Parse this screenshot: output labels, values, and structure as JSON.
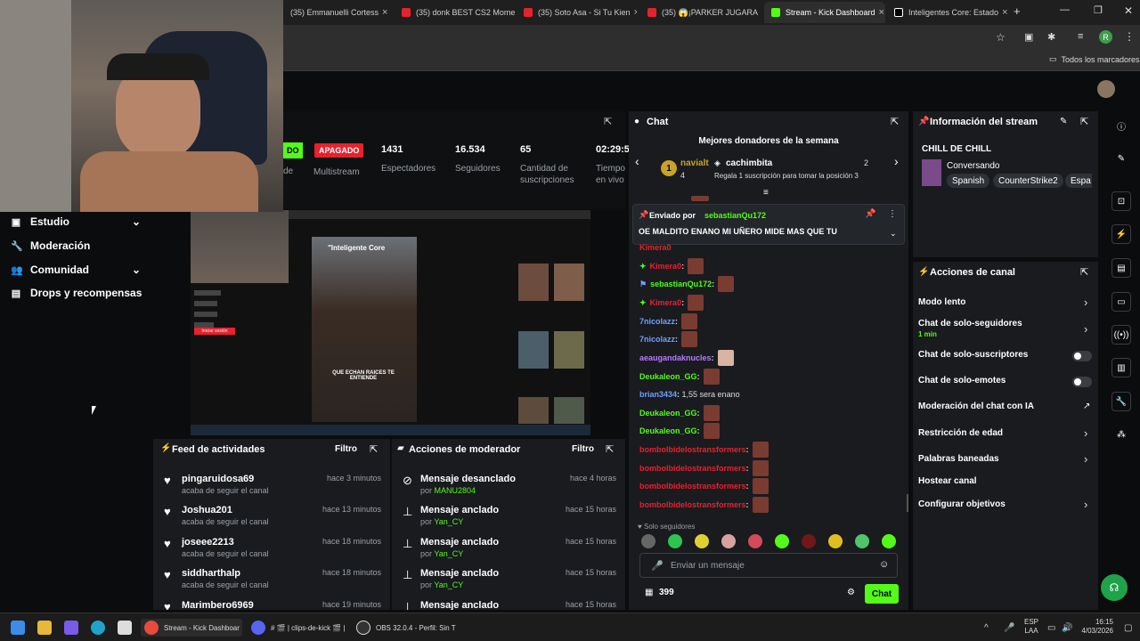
{
  "browser": {
    "tabs": [
      {
        "label": "(35) Emmanuelli Cortess",
        "icon": "youtube-icon"
      },
      {
        "label": "(35) donk BEST CS2 Mome",
        "icon": "youtube-icon"
      },
      {
        "label": "(35) Soto Asa - Si Tu Kien",
        "icon": "youtube-icon"
      },
      {
        "label": "(35) 😱¡PARKER JUGARA",
        "icon": "youtube-icon"
      },
      {
        "label": "Stream - Kick Dashboard",
        "icon": "kick-icon"
      },
      {
        "label": "Inteligentes Core: Estado",
        "icon": "tiktok-icon"
      }
    ],
    "new_tab": "+",
    "bookmarks_label": "Todos los marcadores",
    "profile_initial": "R"
  },
  "sidebar": {
    "items": [
      {
        "label": "Estudio",
        "icon": "studio-icon",
        "chevron": "⌄"
      },
      {
        "label": "Moderación",
        "icon": "wrench-icon"
      },
      {
        "label": "Comunidad",
        "icon": "community-icon",
        "chevron": "⌄"
      },
      {
        "label": "Drops y recompensas",
        "icon": "drops-icon"
      }
    ]
  },
  "stream_stats": {
    "partial_status": "DO",
    "partial_de": "de",
    "multistream_badge": "APAGADO",
    "multistream_label": "Multistream",
    "viewers": "1431",
    "viewers_label": "Espectadores",
    "followers": "16.534",
    "followers_label": "Seguidores",
    "subs": "65",
    "subs_label_1": "Cantidad de",
    "subs_label_2": "suscripciones",
    "uptime": "02:29:5",
    "uptime_label_1": "Tiempo",
    "uptime_label_2": "en vivo"
  },
  "preview": {
    "inner_caption_1": "\"Inteligente Core",
    "inner_caption_2": "QUE ECHAN RAICES TE ENTIENDE",
    "inner_button": "Iniciar sesión"
  },
  "activity_feed": {
    "title": "Feed de actividades",
    "filter": "Filtro",
    "items": [
      {
        "name": "pingaruidosa69",
        "sub": "acaba de seguir el canal",
        "time": "hace 3 minutos"
      },
      {
        "name": "Joshua201",
        "sub": "acaba de seguir el canal",
        "time": "hace 13 minutos"
      },
      {
        "name": "joseee2213",
        "sub": "acaba de seguir el canal",
        "time": "hace 18 minutos"
      },
      {
        "name": "siddharthalp",
        "sub": "acaba de seguir el canal",
        "time": "hace 18 minutos"
      },
      {
        "name": "Marimbero6969",
        "sub": "",
        "time": "hace 19 minutos"
      }
    ]
  },
  "mod_actions": {
    "title": "Acciones de moderador",
    "filter": "Filtro",
    "items": [
      {
        "action": "Mensaje desanclado",
        "by": "por",
        "user": "MANU2804",
        "time": "hace 4 horas"
      },
      {
        "action": "Mensaje anclado",
        "by": "por",
        "user": "Yan_CY",
        "time": "hace 15 horas"
      },
      {
        "action": "Mensaje anclado",
        "by": "por",
        "user": "Yan_CY",
        "time": "hace 15 horas"
      },
      {
        "action": "Mensaje anclado",
        "by": "por",
        "user": "Yan_CY",
        "time": "hace 15 horas"
      },
      {
        "action": "Mensaje anclado",
        "by": "",
        "user": "",
        "time": "hace 15 horas"
      }
    ]
  },
  "chat": {
    "title": "Chat",
    "donors_title": "Mejores donadores de la semana",
    "donor1_rank": "1",
    "donor1_name": "navialt",
    "donor1_count": "4",
    "donor2_name": "cachimbita",
    "donor2_count": "2",
    "donor3_hint": "Regala 1 suscripción para tomar la posición 3",
    "pinned_by_label": "Enviado por",
    "pinned_by_user": "sebastianQu172",
    "pinned_message": "OE MALDITO ENANO MI UÑERO MIDE MAS QUE TU",
    "messages": [
      {
        "user": "Kimera0",
        "text": "",
        "color": "#e8212e",
        "emote": true
      },
      {
        "user": "Kimera0",
        "text": "",
        "color": "#e8212e",
        "emote": true
      },
      {
        "user": "sebastianQu172",
        "text": "",
        "color": "#53fc18",
        "emote": true
      },
      {
        "user": "Kimera0",
        "text": "",
        "color": "#e8212e",
        "emote": true
      },
      {
        "user": "7nicolazz",
        "text": "",
        "color": "#6f9fff",
        "emote": true
      },
      {
        "user": "7nicolazz",
        "text": "",
        "color": "#6f9fff",
        "emote": true
      },
      {
        "user": "aeaugandaknucles",
        "text": "",
        "color": "#b77cff",
        "emote": true
      },
      {
        "user": "Deukaleon_GG",
        "text": "",
        "color": "#53fc18",
        "emote": true
      },
      {
        "user": "brian3434",
        "text": "1,55 sera enano",
        "color": "#6f9fff",
        "emote": false
      },
      {
        "user": "Deukaleon_GG",
        "text": "",
        "color": "#53fc18",
        "emote": true
      },
      {
        "user": "Deukaleon_GG",
        "text": "",
        "color": "#53fc18",
        "emote": true
      },
      {
        "user": "bombolbidelostransformers",
        "text": "",
        "color": "#e8212e",
        "emote": true
      },
      {
        "user": "bombolbidelostransformers",
        "text": "",
        "color": "#e8212e",
        "emote": true
      },
      {
        "user": "bombolbidelostransformers",
        "text": "",
        "color": "#e8212e",
        "emote": true
      },
      {
        "user": "bombolbidelostransformers",
        "text": "",
        "color": "#e8212e",
        "emote": true
      }
    ],
    "followers_only": "Solo seguidores",
    "input_placeholder": "Enviar un mensaje",
    "points": "399",
    "send_label": "Chat"
  },
  "stream_info": {
    "title": "Información del stream",
    "stream_title": "CHILL DE CHILL",
    "category": "Conversando",
    "tags": [
      "Spanish",
      "CounterStrike2",
      "Espa"
    ]
  },
  "channel_actions": {
    "title": "Acciones de canal",
    "items": [
      {
        "label": "Modo lento",
        "sub": "",
        "control": "chevron"
      },
      {
        "label": "Chat de solo-seguidores",
        "sub": "1 min",
        "control": "chevron"
      },
      {
        "label": "Chat de solo-suscriptores",
        "sub": "",
        "control": "toggle"
      },
      {
        "label": "Chat de solo-emotes",
        "sub": "",
        "control": "toggle"
      },
      {
        "label": "Moderación del chat con IA",
        "sub": "",
        "control": "external"
      },
      {
        "label": "Restricción de edad",
        "sub": "",
        "control": "chevron"
      },
      {
        "label": "Palabras baneadas",
        "sub": "",
        "control": "chevron"
      },
      {
        "label": "Hostear canal",
        "sub": "",
        "control": "none"
      },
      {
        "label": "Configurar objetivos",
        "sub": "",
        "control": "chevron"
      }
    ]
  },
  "taskbar": {
    "chrome_label": "Stream - Kick Dashboar",
    "discord_label": "# 🎬 | clips-de-kick 🎬 |",
    "obs_label": "OBS 32.0.4 - Perfil: Sin T",
    "lang_1": "ESP",
    "lang_2": "LAA",
    "time": "16:15",
    "date": "4/03/2026"
  },
  "colors": {
    "kick_green": "#53fc18",
    "panel": "#191b1f",
    "bg": "#0b0c0d",
    "red_badge": "#e8212e"
  }
}
